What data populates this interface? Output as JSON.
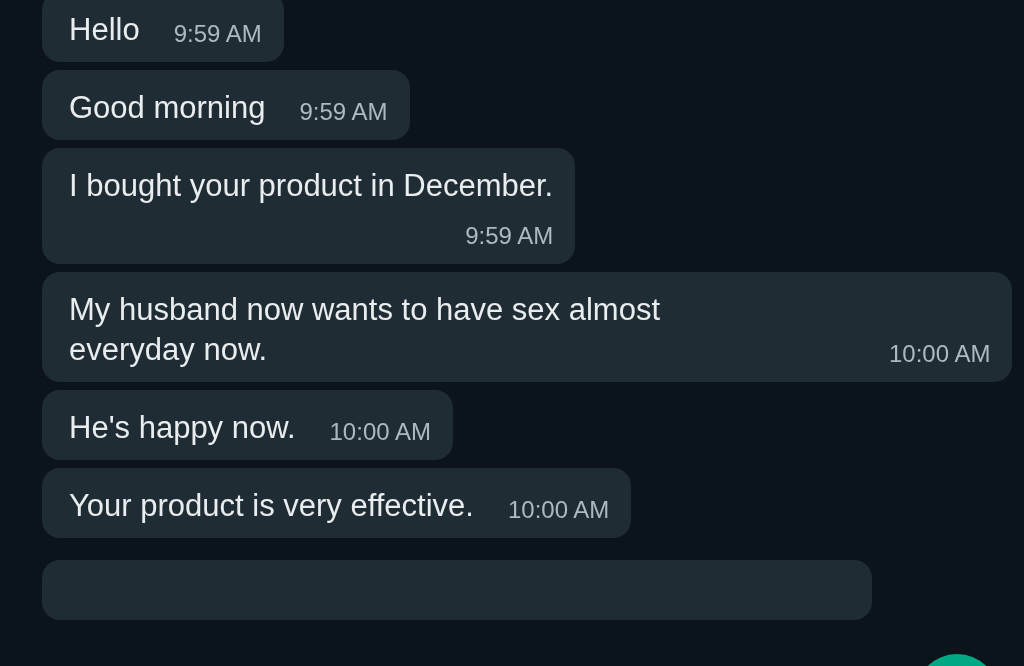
{
  "messages": [
    {
      "text": "Hello",
      "time": "9:59 AM",
      "kind": "inline"
    },
    {
      "text": "Good morning",
      "time": "9:59 AM",
      "kind": "inline"
    },
    {
      "text": "I bought your product in December.",
      "time": "9:59 AM",
      "kind": "stacked"
    },
    {
      "text": "My husband now wants to have sex almost everyday now.",
      "time": "10:00 AM",
      "kind": "wrapped"
    },
    {
      "text": "He's happy now.",
      "time": "10:00 AM",
      "kind": "inline"
    },
    {
      "text": "Your product is very effective.",
      "time": "10:00 AM",
      "kind": "inline"
    }
  ]
}
